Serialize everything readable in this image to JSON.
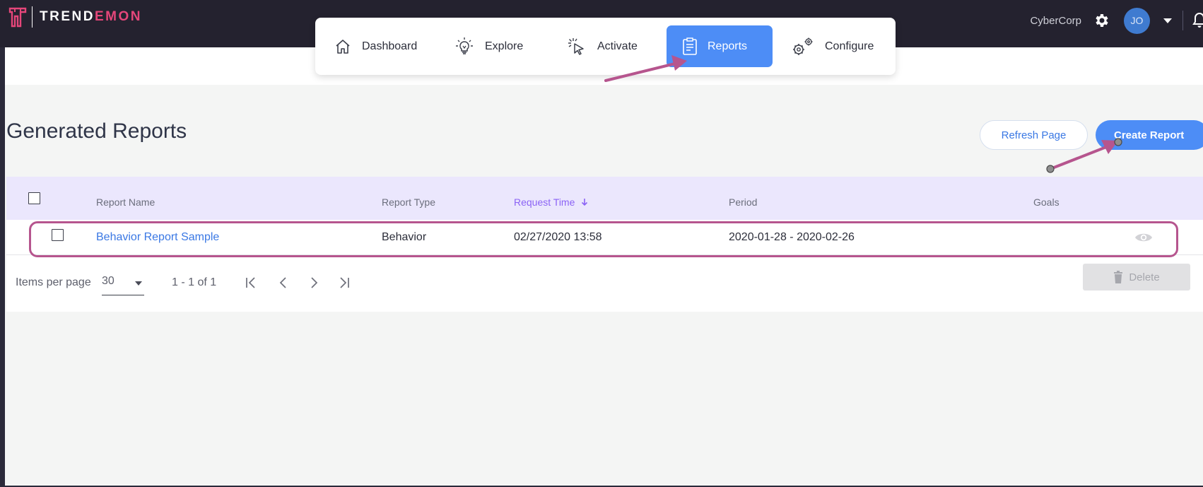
{
  "brand": {
    "logo_part1": "TREND",
    "logo_part2": "EMON",
    "accent": "#e5467a"
  },
  "account": {
    "name": "CyberCorp",
    "avatar_initials": "JO"
  },
  "nav": {
    "items": [
      {
        "label": "Dashboard",
        "icon": "home-icon"
      },
      {
        "label": "Explore",
        "icon": "lightbulb-icon"
      },
      {
        "label": "Activate",
        "icon": "cursor-click-icon"
      },
      {
        "label": "Reports",
        "icon": "report-clipboard-icon",
        "active": true
      },
      {
        "label": "Configure",
        "icon": "gears-icon"
      }
    ],
    "active_color": "#4d8df6"
  },
  "page": {
    "title": "Generated Reports",
    "refresh_label": "Refresh Page",
    "create_label": "Create Report"
  },
  "table": {
    "columns": [
      "Report Name",
      "Report Type",
      "Request Time",
      "Period",
      "Goals"
    ],
    "sort_column": "Request Time",
    "sort_direction": "descending",
    "rows": [
      {
        "name": "Behavior Report Sample",
        "type": "Behavior",
        "request_time": "02/27/2020 13:58",
        "period": "2020-01-28 - 2020-02-26",
        "goals": ""
      }
    ]
  },
  "pagination": {
    "items_per_page_label": "Items per page",
    "items_per_page": "30",
    "range": "1 - 1 of 1"
  },
  "actions": {
    "delete_label": "Delete"
  },
  "annotation_color": "#b6558e"
}
